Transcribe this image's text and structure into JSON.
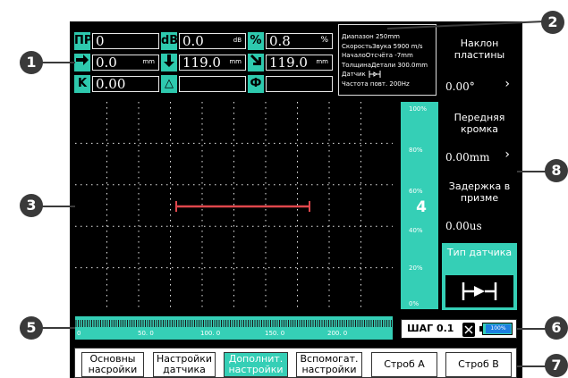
{
  "callouts": [
    "1",
    "2",
    "3",
    "4",
    "5",
    "6",
    "7",
    "8"
  ],
  "params": {
    "row1": [
      {
        "label": "ПР",
        "value": "0",
        "unit": ""
      },
      {
        "label": "dB",
        "value": "0.0",
        "unit": "dB"
      },
      {
        "label": "%",
        "value": "0.8",
        "unit": "%"
      }
    ],
    "row2": [
      {
        "icon": "arrow-right-icon",
        "value": "0.0",
        "unit": "mm"
      },
      {
        "icon": "arrow-down-icon",
        "value": "119.0",
        "unit": "mm"
      },
      {
        "icon": "arrow-diagonal-icon",
        "value": "119.0",
        "unit": "mm"
      }
    ],
    "row3": [
      {
        "label": "K",
        "value": "0.00"
      },
      {
        "label": "△",
        "value": ""
      },
      {
        "label": "Ф",
        "value": ""
      }
    ]
  },
  "info": {
    "lines": [
      "Диапазон 250mm",
      "СкоростьЗвука 5900 m/s",
      "НачалоОтсчёта -7mm",
      "ТолщинаДетали 300.0mm",
      "Датчик",
      "Частота повт. 200Hz"
    ]
  },
  "right_panels": {
    "incline": {
      "title": "Наклон пластины",
      "value": "0.00°",
      "chevron": "›"
    },
    "front": {
      "title": "Передняя кромка",
      "value": "0.00mm",
      "chevron": "›"
    },
    "delay": {
      "title": "Задержка в призме",
      "value": "0.00us"
    },
    "probe": {
      "title": "Тип датчика",
      "symbol": "⊣▸⊢"
    }
  },
  "vscale_ticks": [
    "100%",
    "80%",
    "60%",
    "40%",
    "20%",
    "0%"
  ],
  "hscale_labels": [
    "0",
    "50. 0",
    "100. 0",
    "150. 0",
    "200. 0"
  ],
  "status": {
    "step_label": "ШАГ 0.1",
    "battery": "100%"
  },
  "menu": [
    {
      "label": "Основны насройки",
      "active": false
    },
    {
      "label": "Настройки датчика",
      "active": false
    },
    {
      "label": "Дополнит. настройки",
      "active": true
    },
    {
      "label": "Вспомогат. настройки",
      "active": false
    },
    {
      "label": "Строб А",
      "active": false
    },
    {
      "label": "Строб В",
      "active": false
    }
  ],
  "colors": {
    "accent": "#35cfb6",
    "gate": "#e0474c",
    "callout": "#3a3a3a"
  }
}
